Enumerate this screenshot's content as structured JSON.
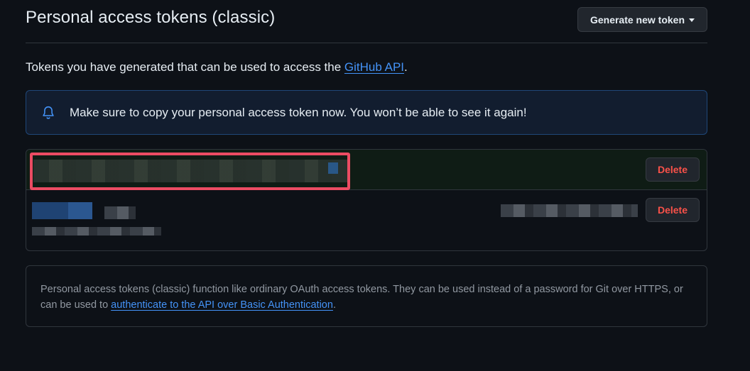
{
  "header": {
    "title": "Personal access tokens (classic)",
    "generate_button_label": "Generate new token"
  },
  "intro": {
    "text": "Tokens you have generated that can be used to access the ",
    "link_text": "GitHub API",
    "suffix": "."
  },
  "flash": {
    "icon": "bell-icon",
    "message": "Make sure to copy your personal access token now. You won’t be able to see it again!"
  },
  "tokens": {
    "rows": [
      {
        "delete_label": "Delete",
        "highlighted": true
      },
      {
        "delete_label": "Delete",
        "highlighted": false
      }
    ]
  },
  "info": {
    "text": "Personal access tokens (classic) function like ordinary OAuth access tokens. They can be used instead of a password for Git over HTTPS, or can be used to ",
    "link_text": "authenticate to the API over Basic Authentication",
    "suffix": "."
  },
  "colors": {
    "background": "#0d1117",
    "accent_link": "#4493f8",
    "danger": "#f85149",
    "highlight_border": "#eb4c63",
    "new_token_row": "#0f1c15"
  }
}
